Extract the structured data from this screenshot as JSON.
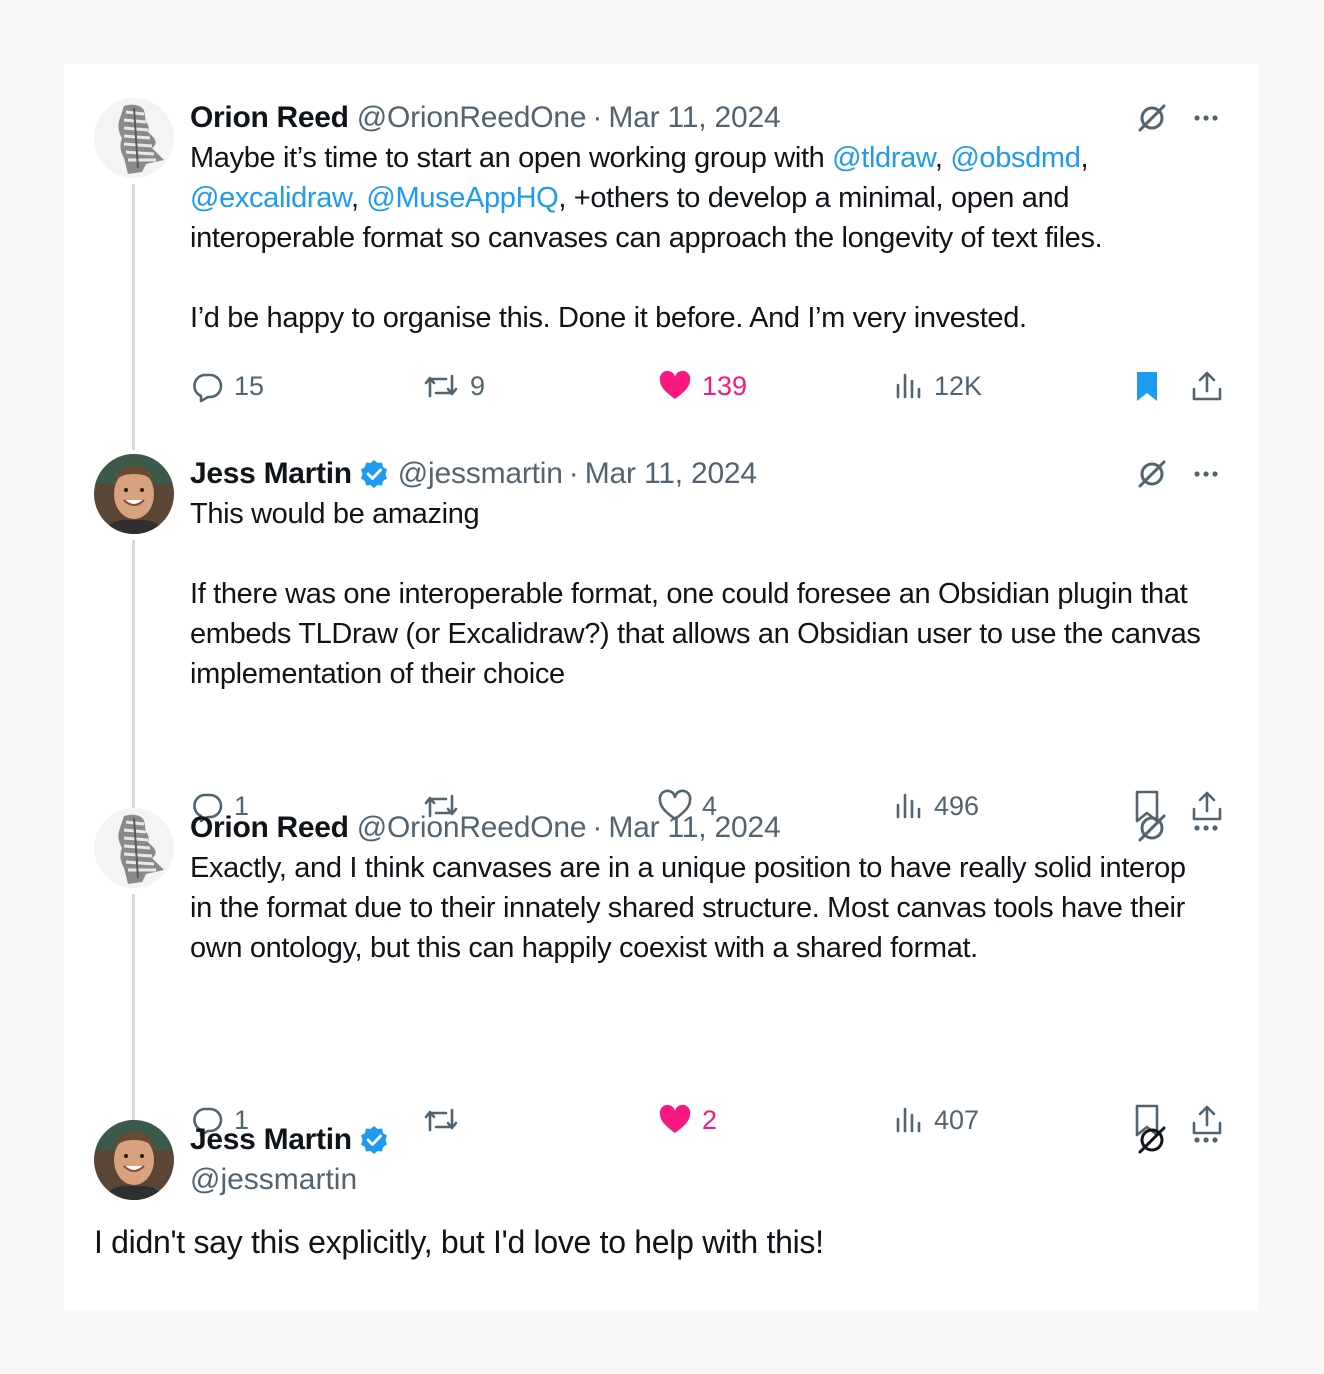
{
  "tweets": [
    {
      "name": "Orion Reed",
      "handle": "@OrionReedOne",
      "separator": "·",
      "date": "Mar 11, 2024",
      "verified": false,
      "body": {
        "p1_a": "Maybe it’s time to start an open working group with ",
        "m1": "@tldraw",
        "p1_b": ", ",
        "m2": "@obsdmd",
        "p1_c": ", ",
        "m3": "@excalidraw",
        "p1_d": ", ",
        "m4": "@MuseAppHQ",
        "p1_e": ", +others to develop a minimal, open and interoperable format so canvases can approach the longevity of text files.",
        "p2": "I’d be happy to organise this. Done it before. And I’m very invested."
      },
      "stats": {
        "replies": "15",
        "reposts": "9",
        "likes": "139",
        "views": "12K"
      },
      "liked": true,
      "bookmarked": true
    },
    {
      "name": "Jess Martin",
      "handle": "@jessmartin",
      "separator": "·",
      "date": "Mar 11, 2024",
      "verified": true,
      "body": {
        "p1": "This would be amazing",
        "p2": "If there was one interoperable format, one could foresee an Obsidian plugin that embeds TLDraw (or Excalidraw?) that allows an Obsidian user to use the canvas implementation of their choice"
      },
      "stats": {
        "replies": "1",
        "reposts": "",
        "likes": "4",
        "views": "496"
      },
      "liked": false,
      "bookmarked": false
    },
    {
      "name": "Orion Reed",
      "handle": "@OrionReedOne",
      "separator": "·",
      "date": "Mar 11, 2024",
      "verified": false,
      "body": {
        "p1": "Exactly, and I think canvases are in a unique position to have really solid interop in the format due to their innately shared structure. Most canvas tools have their own ontology, but this can happily coexist with a shared format."
      },
      "stats": {
        "replies": "1",
        "reposts": "",
        "likes": "2",
        "views": "407"
      },
      "liked": true,
      "bookmarked": false
    }
  ],
  "final_tweet": {
    "name": "Jess Martin",
    "handle": "@jessmartin",
    "verified": true,
    "text": "I didn't say this explicitly, but I'd love to help with this!"
  },
  "colors": {
    "accent": "#1d9bf0",
    "like": "#f91880",
    "secondary": "#536471",
    "thread_line": "#cfd9de"
  },
  "icons": [
    "grok-slash-icon",
    "more-icon",
    "reply-icon",
    "repost-icon",
    "like-icon",
    "views-icon",
    "bookmark-icon",
    "share-icon",
    "verified-badge-icon"
  ]
}
